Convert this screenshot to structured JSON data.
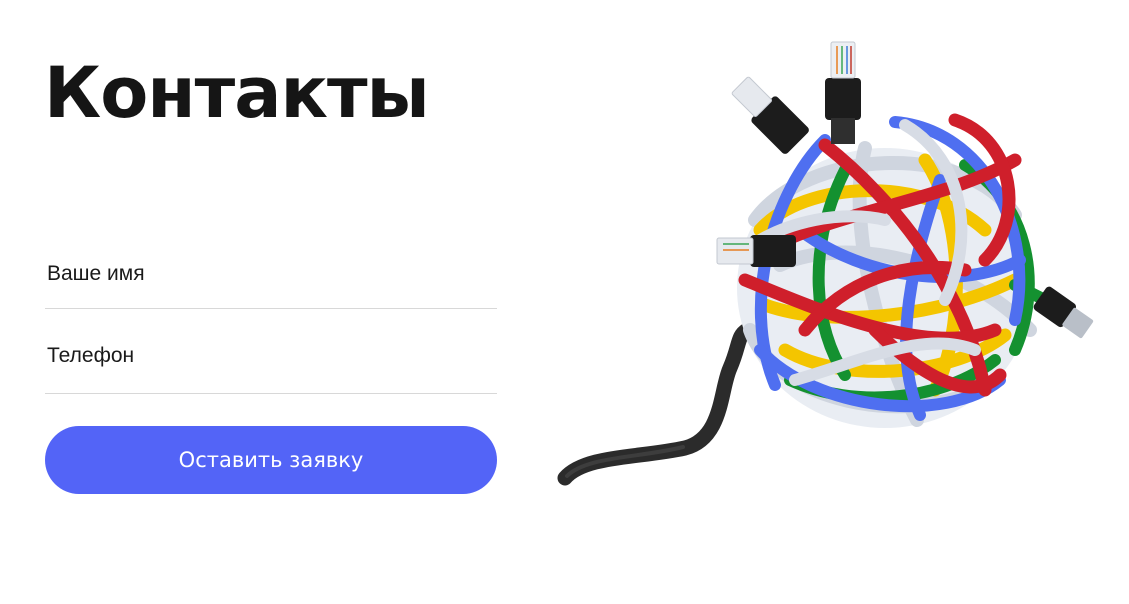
{
  "page": {
    "title": "Контакты"
  },
  "form": {
    "name_placeholder": "Ваше имя",
    "phone_placeholder": "Телефон",
    "submit_label": "Оставить заявку"
  },
  "colors": {
    "accent": "#5364f7",
    "cable_red": "#cf1f2b",
    "cable_blue": "#4f6ff0",
    "cable_yellow": "#f4c500",
    "cable_green": "#149130",
    "cable_white": "#d7dce5",
    "cable_black": "#262626"
  },
  "illustration": {
    "icon": "tangled-cables-icon"
  }
}
